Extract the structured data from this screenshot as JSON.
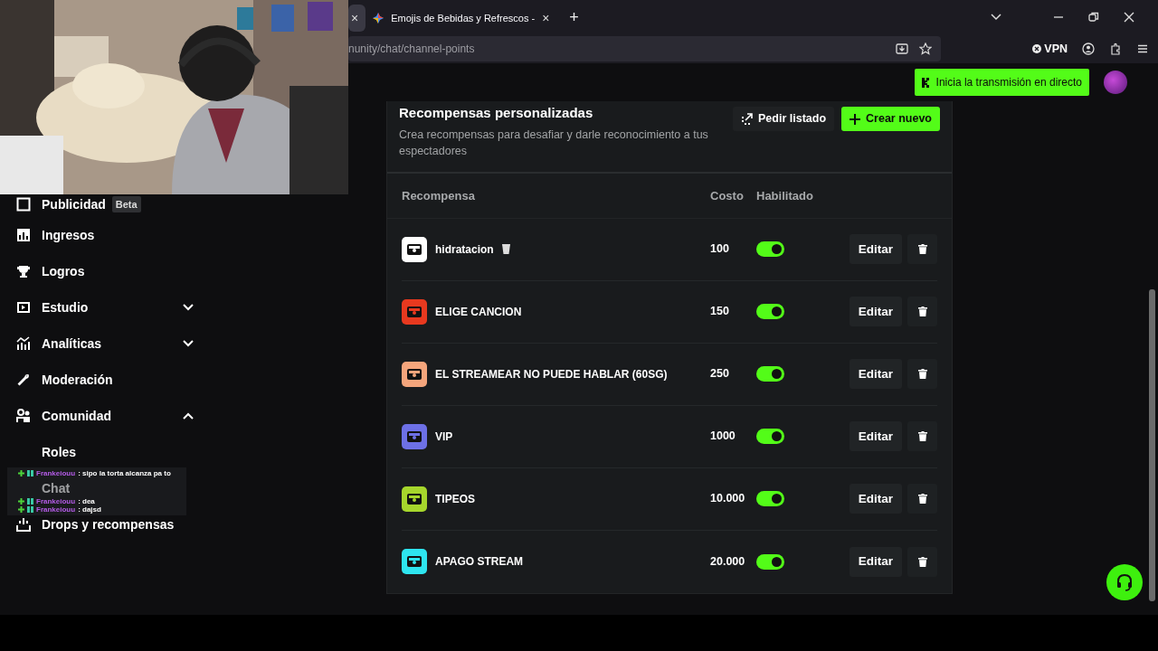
{
  "browser": {
    "tabs": [
      {
        "close": "×",
        "selected": true
      },
      {
        "title": "Emojis de Bebidas y Refrescos -",
        "close": "×",
        "selected": false
      }
    ],
    "new_tab": "+",
    "url": "nunity/chat/channel-points",
    "vpn": "VPN"
  },
  "header": {
    "go_live_button": "Inicia la transmisión en directo"
  },
  "sidebar": {
    "items": [
      {
        "label": "Publicidad",
        "badge": "Beta"
      },
      {
        "label": "Ingresos"
      },
      {
        "label": "Logros"
      },
      {
        "label": "Estudio",
        "expanded": false
      },
      {
        "label": "Analíticas",
        "expanded": false
      },
      {
        "label": "Moderación"
      },
      {
        "label": "Comunidad",
        "expanded": true,
        "children": [
          {
            "label": "Roles"
          },
          {
            "label": "Chat"
          }
        ]
      },
      {
        "label": "Drops y recompensas"
      }
    ]
  },
  "rewards": {
    "title": "Recompensas personalizadas",
    "description": "Crea recompensas para desafiar y darle reconocimiento a tus espectadores",
    "buttons": [
      {
        "label": "Pedir listado",
        "kind": "secondary"
      },
      {
        "label": "Crear nuevo",
        "kind": "primary"
      }
    ],
    "columns": [
      "Recompensa",
      "Costo",
      "Habilitado"
    ],
    "rows": [
      {
        "name": "hidratacion",
        "cup": true,
        "cost": "100",
        "enabled": true,
        "color": "#ffffff",
        "edit": "Editar"
      },
      {
        "name": "ELIGE CANCION",
        "cost": "150",
        "enabled": true,
        "color": "#e8391f",
        "edit": "Editar"
      },
      {
        "name": "EL STREAMEAR NO PUEDE HABLAR (60SG)",
        "cost": "250",
        "enabled": true,
        "color": "#f4a57c",
        "edit": "Editar"
      },
      {
        "name": "VIP",
        "cost": "1000",
        "enabled": true,
        "color": "#6d70e6",
        "edit": "Editar"
      },
      {
        "name": "TIPEOS",
        "cost": "10.000",
        "enabled": true,
        "color": "#a6d62c",
        "edit": "Editar"
      },
      {
        "name": "APAGO STREAM",
        "cost": "20.000",
        "enabled": true,
        "color": "#2ee5ef",
        "edit": "Editar"
      }
    ]
  },
  "chat_overlay": {
    "messages": [
      {
        "user": "Frankeiouu",
        "text": ": sipo la torta alcanza pa to"
      },
      {
        "user": "Frankeiouu",
        "text": ": dea"
      },
      {
        "user": "Frankeiouu",
        "text": ": dajsd"
      }
    ]
  }
}
